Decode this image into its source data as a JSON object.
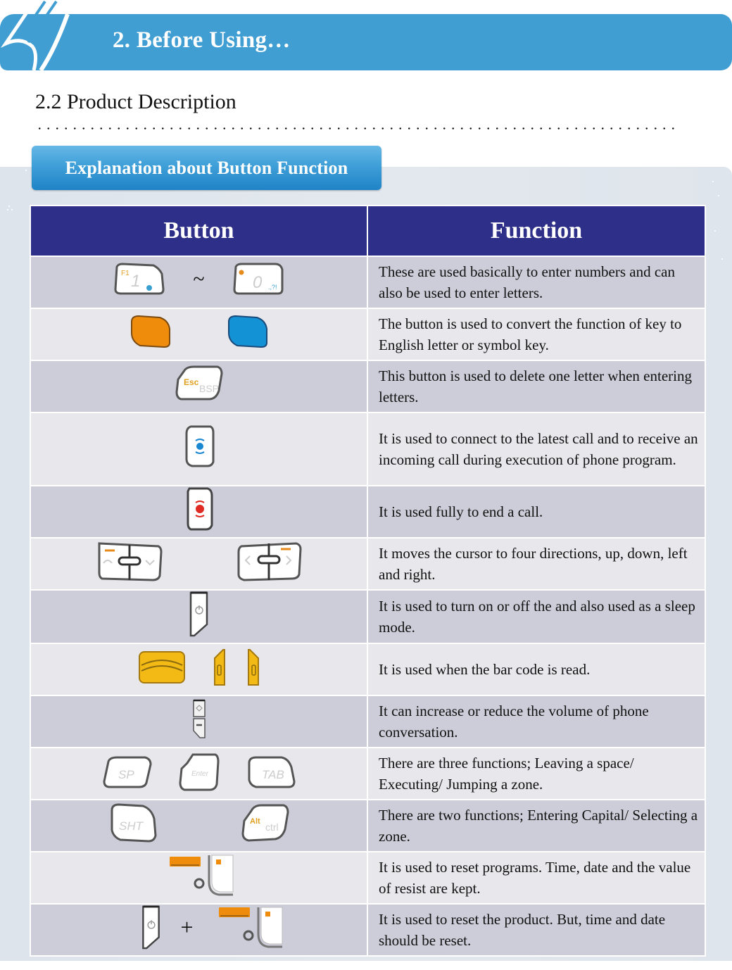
{
  "header": {
    "chapter_title": "2. Before Using…",
    "accent_color": "#419ed3"
  },
  "section": {
    "title": "2.2 Product Description",
    "tab_label": "Explanation about Button Function",
    "tab_color": "#2a8fd0"
  },
  "table": {
    "header_color": "#2e2f88",
    "columns": [
      "Button",
      "Function"
    ],
    "rows": [
      {
        "icons": [
          "key-1-f1-icon",
          "key-0-icon"
        ],
        "separator": "~",
        "function": "These are used basically to enter numbers and can also be used to enter letters."
      },
      {
        "icons": [
          "orange-function-key-icon",
          "blue-function-key-icon"
        ],
        "separator": "",
        "function": "The button is used to convert the function of key to English letter or symbol key."
      },
      {
        "icons": [
          "esc-bsp-key-icon"
        ],
        "separator": "",
        "function": "This button is used to delete one letter when entering letters."
      },
      {
        "icons": [
          "call-send-key-icon"
        ],
        "separator": "",
        "function": "It is used to connect to the latest call and to receive an incoming call during execution of phone program."
      },
      {
        "icons": [
          "call-end-key-icon"
        ],
        "separator": "",
        "function": "It is used fully to end a call."
      },
      {
        "icons": [
          "up-down-nav-key-icon",
          "left-right-nav-key-icon"
        ],
        "separator": "",
        "function": "It moves the cursor to four directions, up, down, left and right."
      },
      {
        "icons": [
          "power-key-icon"
        ],
        "separator": "",
        "function": "It is used to turn on or off the and also used as a sleep mode."
      },
      {
        "icons": [
          "scan-key-front-icon",
          "scan-key-left-side-icon",
          "scan-key-right-side-icon"
        ],
        "separator": "",
        "function": "It is used when the bar code is read."
      },
      {
        "icons": [
          "volume-key-icon"
        ],
        "separator": "",
        "function": "It can increase or reduce the volume of phone conversation."
      },
      {
        "icons": [
          "sp-key-icon",
          "enter-key-icon",
          "tab-key-icon"
        ],
        "separator": "",
        "function": "There are three functions; Leaving a space/ Executing/ Jumping a zone."
      },
      {
        "icons": [
          "sht-key-icon",
          "alt-ctrl-key-icon"
        ],
        "separator": "",
        "function": "There are two functions; Entering Capital/ Selecting a zone."
      },
      {
        "icons": [
          "reset-hole-icon"
        ],
        "separator": "",
        "function": "It is used to reset programs.  Time, date and the value of resist are kept."
      },
      {
        "icons": [
          "power-key-icon",
          "reset-hole-icon"
        ],
        "separator": "+",
        "function": "It is used to reset the product. But, time and date should be reset."
      }
    ],
    "key_labels": {
      "f1": "F1",
      "one": "1",
      "zero": "0",
      "esc": "Esc",
      "bsp": "BSP",
      "sp": "SP",
      "enter": "Enter",
      "tab": "TAB",
      "sht": "SHT",
      "alt": "Alt",
      "ctrl": "ctrl"
    }
  }
}
